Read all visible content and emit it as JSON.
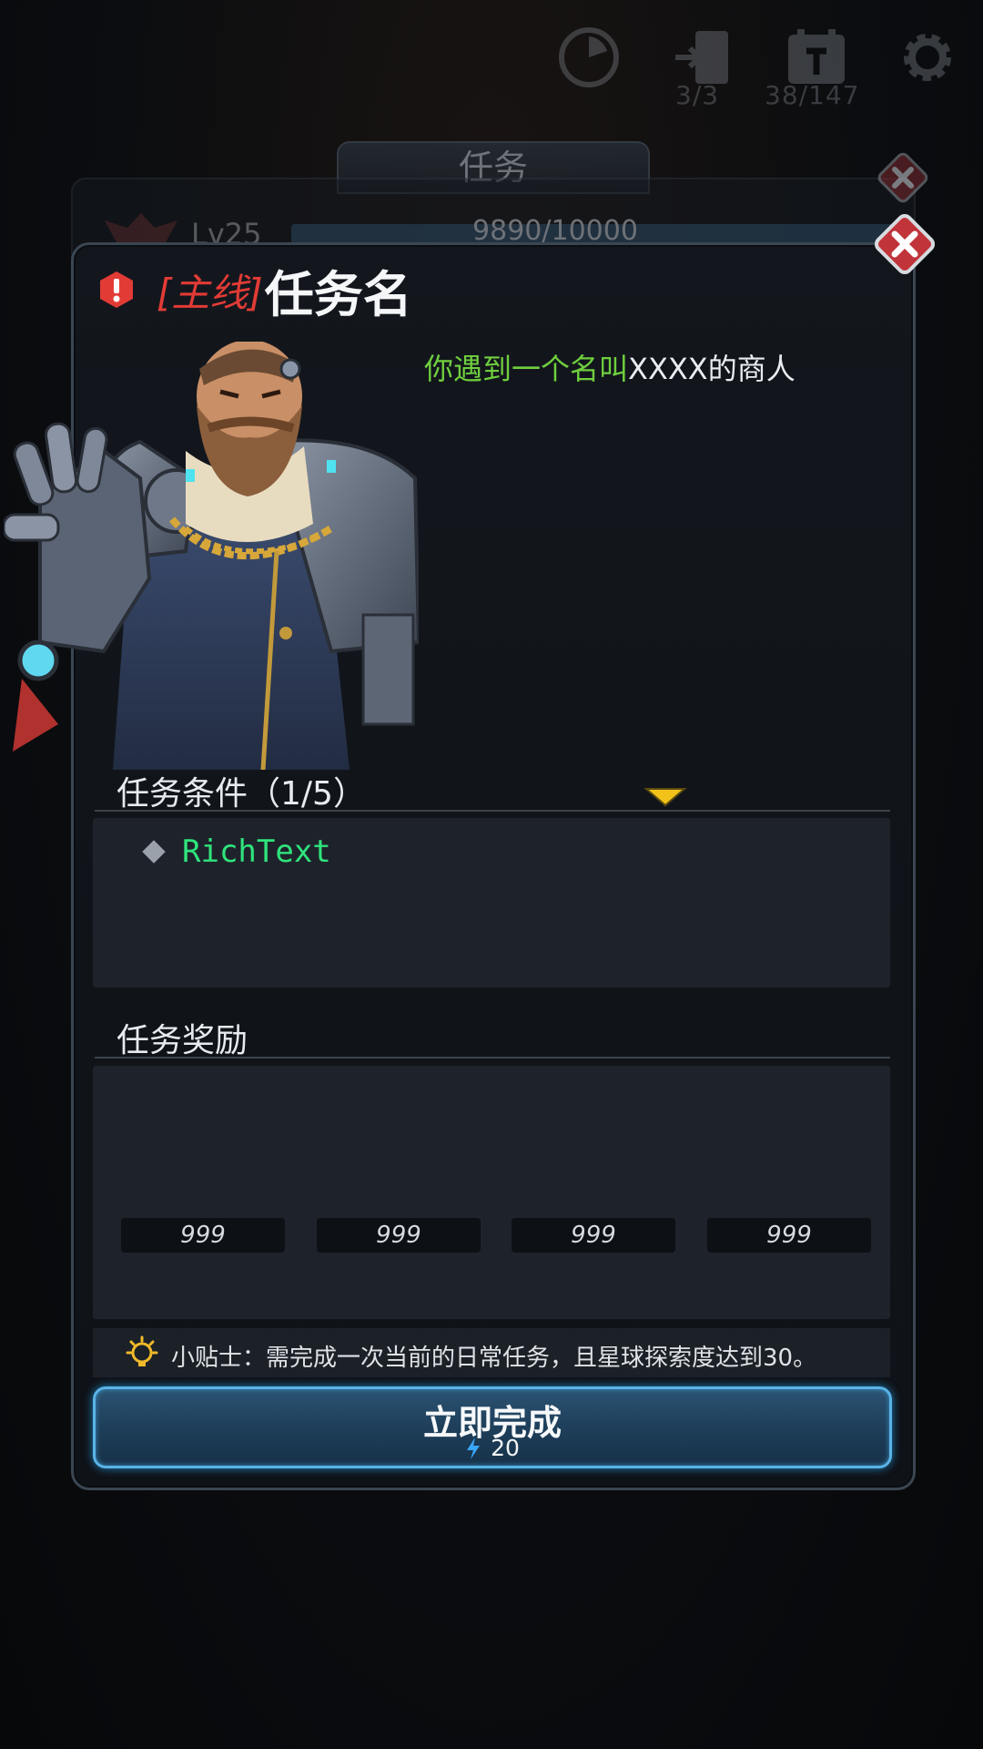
{
  "background": {
    "hud": {
      "stamina_count": "3/3",
      "calendar_count": "38/147"
    },
    "back_panel": {
      "tab_title": "任务",
      "level": "Lv25",
      "exp": "9890/10000"
    }
  },
  "dialog": {
    "tag": "[主线]",
    "quest_name": "任务名",
    "description_highlight": "你遇到一个名叫",
    "description_rest": "XXXX的商人",
    "conditions": {
      "title": "任务条件（1/5）",
      "items": [
        "RichText"
      ]
    },
    "rewards": {
      "title": "任务奖励",
      "counts": [
        "999",
        "999",
        "999",
        "999"
      ]
    },
    "tip": "小贴士：需完成一次当前的日常任务，且星球探索度达到30。",
    "complete_button": {
      "label": "立即完成",
      "cost": "20"
    }
  },
  "colors": {
    "accent_red": "#e23b36",
    "highlight_green": "#6fcf3e",
    "richtext_green": "#2fe47c",
    "button_border": "#5ab3e6",
    "arrow_yellow": "#f2c21a"
  },
  "icons": {
    "alert": "exclamation-alert-icon",
    "close": "close-x-icon",
    "dropdown": "triangle-down-icon",
    "tip": "lightbulb-icon",
    "energy": "lightning-bolt-icon"
  }
}
